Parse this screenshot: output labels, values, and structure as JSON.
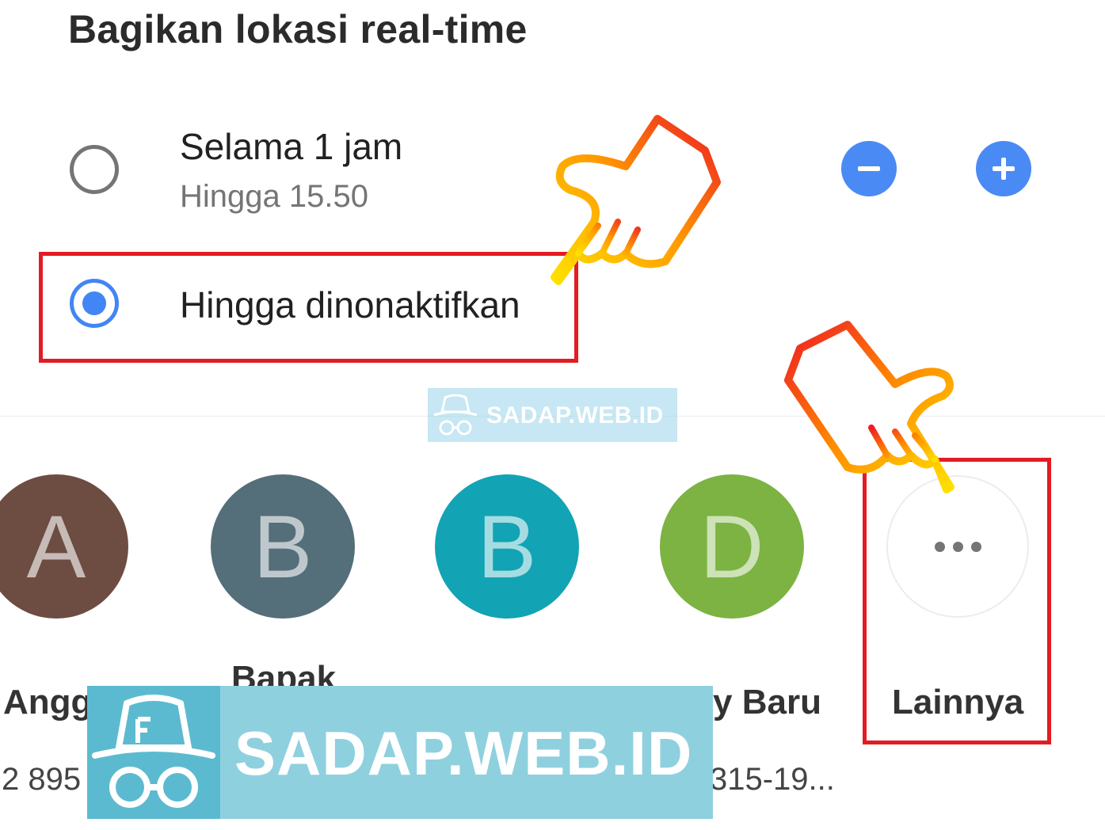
{
  "title": "Bagikan lokasi real-time",
  "options": [
    {
      "label": "Selama 1 jam",
      "sub": "Hingga 15.50",
      "selected": false
    },
    {
      "label": "Hingga dinonaktifkan",
      "sub": "",
      "selected": true
    }
  ],
  "stepper": {
    "minus_icon": "minus-icon",
    "plus_icon": "plus-icon"
  },
  "contacts": [
    {
      "initial": "A",
      "name": "Angg",
      "phone": "2 895",
      "color": "#6d4c41"
    },
    {
      "initial": "B",
      "name": "Bapak",
      "phone": "",
      "color": "#546e7a"
    },
    {
      "initial": "B",
      "name": "",
      "phone": "",
      "color": "#12a3b4"
    },
    {
      "initial": "D",
      "name": "y Baru",
      "phone": "315-19...",
      "color": "#7cb342"
    }
  ],
  "more": {
    "label": "Lainnya"
  },
  "watermark": "SADAP.WEB.ID",
  "colors": {
    "accent": "#4285f4",
    "highlight": "#e31b23"
  }
}
